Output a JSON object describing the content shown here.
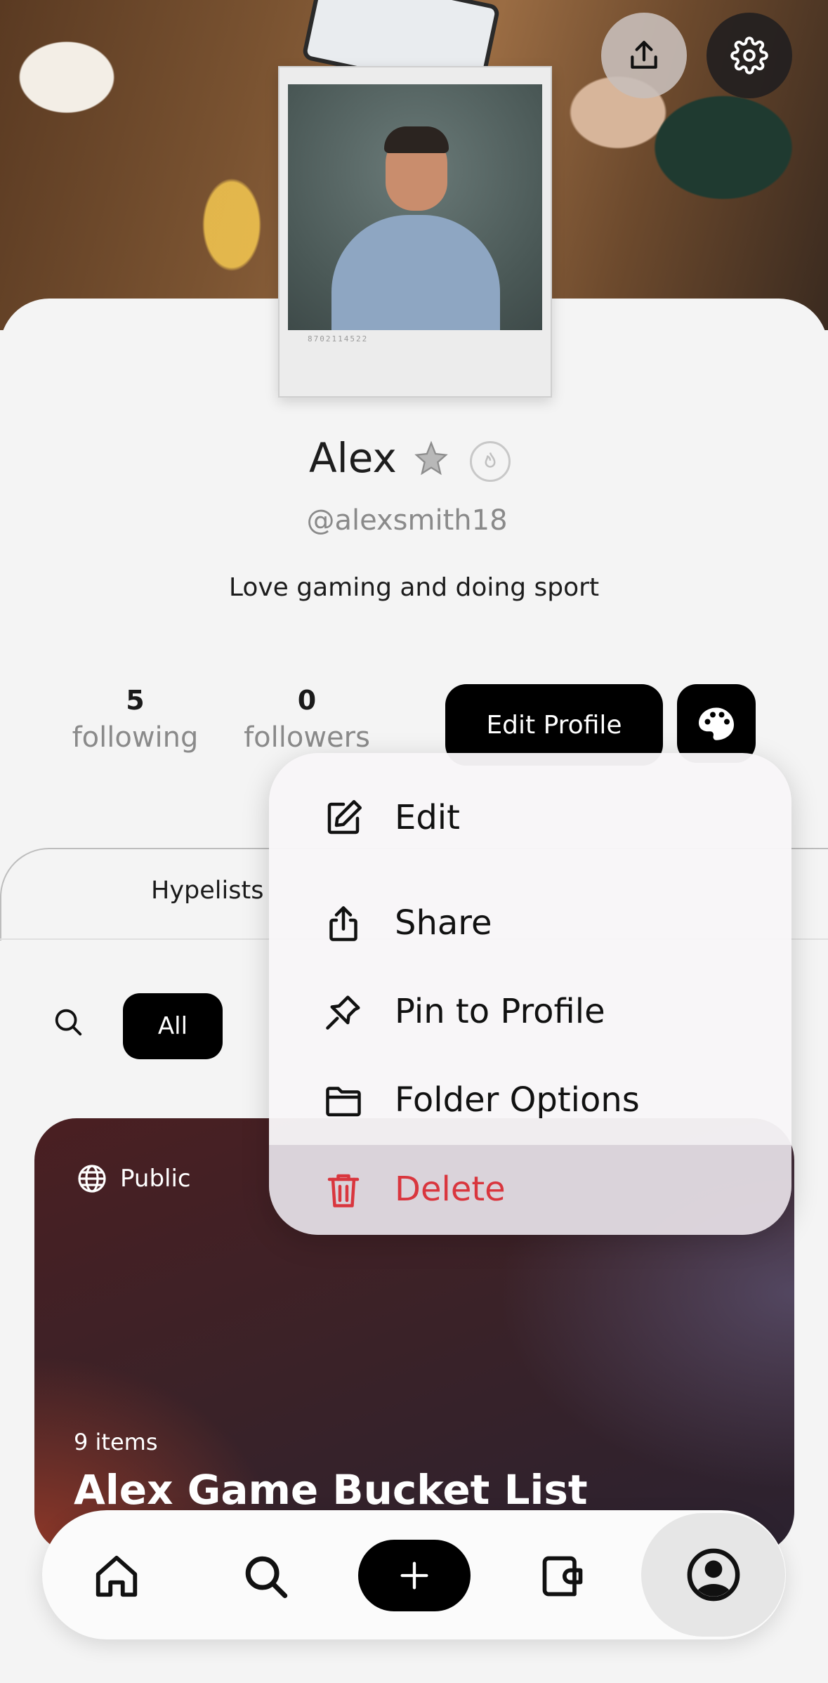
{
  "profile": {
    "name": "Alex",
    "handle": "@alexsmith18",
    "bio": "Love gaming and doing sport",
    "polaroid_serial": "8702114522"
  },
  "stats": {
    "following_count": "5",
    "following_label": "following",
    "followers_count": "0",
    "followers_label": "followers"
  },
  "actions": {
    "edit_profile": "Edit Profile"
  },
  "tabs": {
    "hypelists": "Hypelists"
  },
  "filters": {
    "all": "All"
  },
  "card": {
    "visibility": "Public",
    "items": "9 items",
    "title": "Alex Game Bucket List"
  },
  "menu": {
    "edit": "Edit",
    "share": "Share",
    "pin": "Pin to Profile",
    "folder": "Folder Options",
    "delete": "Delete"
  },
  "colors": {
    "delete": "#d9363e",
    "primary_button": "#000000"
  },
  "icons": {
    "top": [
      "share-icon",
      "gear-icon"
    ],
    "nav": [
      "home-icon",
      "search-icon",
      "plus-icon",
      "wallet-icon",
      "profile-icon"
    ]
  }
}
